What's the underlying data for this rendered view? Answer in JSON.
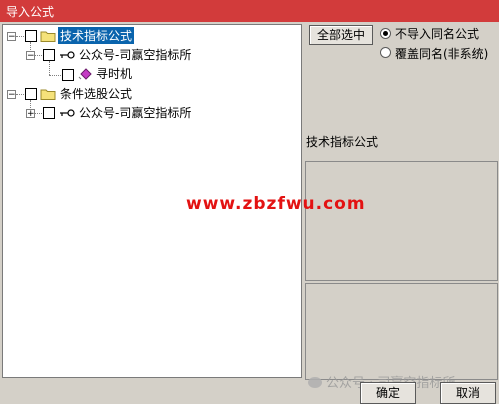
{
  "window": {
    "title": "导入公式"
  },
  "tree": {
    "nodes": [
      {
        "label": "技术指标公式",
        "selected": true,
        "expander": "−"
      },
      {
        "label": "公众号-司赢空指标所",
        "expander": "−"
      },
      {
        "label": "寻时机"
      },
      {
        "label": "条件选股公式",
        "expander": "−"
      },
      {
        "label": "公众号-司赢空指标所",
        "expander": "+"
      }
    ]
  },
  "buttons": {
    "select_all": "全部选中",
    "ok": "确定",
    "cancel": "取消"
  },
  "options": {
    "no_import_same_name": "不导入同名公式",
    "overwrite_same_name": "覆盖同名(非系统)",
    "selected": "no_import_same_name"
  },
  "description": {
    "label": "技术指标公式"
  },
  "watermarks": {
    "site": "www.zbzfwu.com",
    "wechat": "公众号 · 司赢空指标所"
  },
  "colors": {
    "title_bar": "#d23b3b",
    "selection": "#0a64ad",
    "watermark": "#e31212"
  }
}
